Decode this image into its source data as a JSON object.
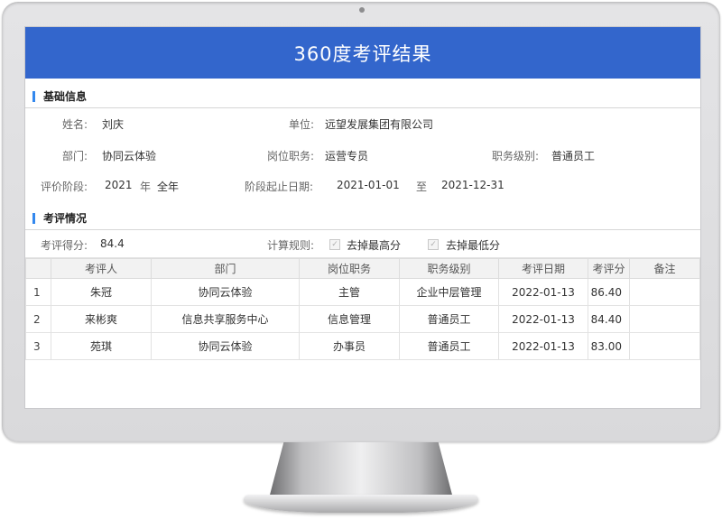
{
  "title": "360度考评结果",
  "sections": {
    "basic": "基础信息",
    "eval": "考评情况"
  },
  "basic": {
    "name_label": "姓名:",
    "name": "刘庆",
    "unit_label": "单位:",
    "unit": "远望发展集团有限公司",
    "dept_label": "部门:",
    "dept": "协同云体验",
    "post_label": "岗位职务:",
    "post": "运营专员",
    "level_label": "职务级别:",
    "level": "普通员工",
    "stage_label": "评价阶段:",
    "stage_year": "2021",
    "stage_year_unit": "年",
    "stage_period": "全年",
    "date_label": "阶段起止日期:",
    "date_start": "2021-01-01",
    "date_to": "至",
    "date_end": "2021-12-31"
  },
  "score": {
    "label": "考评得分:",
    "value": "84.4",
    "rule_label": "计算规则:",
    "rule_drop_max": "去掉最高分",
    "rule_drop_min": "去掉最低分"
  },
  "table": {
    "headers": [
      "",
      "考评人",
      "部门",
      "岗位职务",
      "职务级别",
      "考评日期",
      "考评分",
      "备注"
    ],
    "rows": [
      [
        "1",
        "朱冠",
        "协同云体验",
        "主管",
        "企业中层管理",
        "2022-01-13",
        "86.40",
        ""
      ],
      [
        "2",
        "来彬爽",
        "信息共享服务中心",
        "信息管理",
        "普通员工",
        "2022-01-13",
        "84.40",
        ""
      ],
      [
        "3",
        "苑琪",
        "协同云体验",
        "办事员",
        "普通员工",
        "2022-01-13",
        "83.00",
        ""
      ]
    ]
  },
  "icons": {
    "check": "checkmark-icon",
    "camera": "camera-icon"
  },
  "colors": {
    "header_bg": "#3366cc",
    "accent": "#3388ee"
  }
}
